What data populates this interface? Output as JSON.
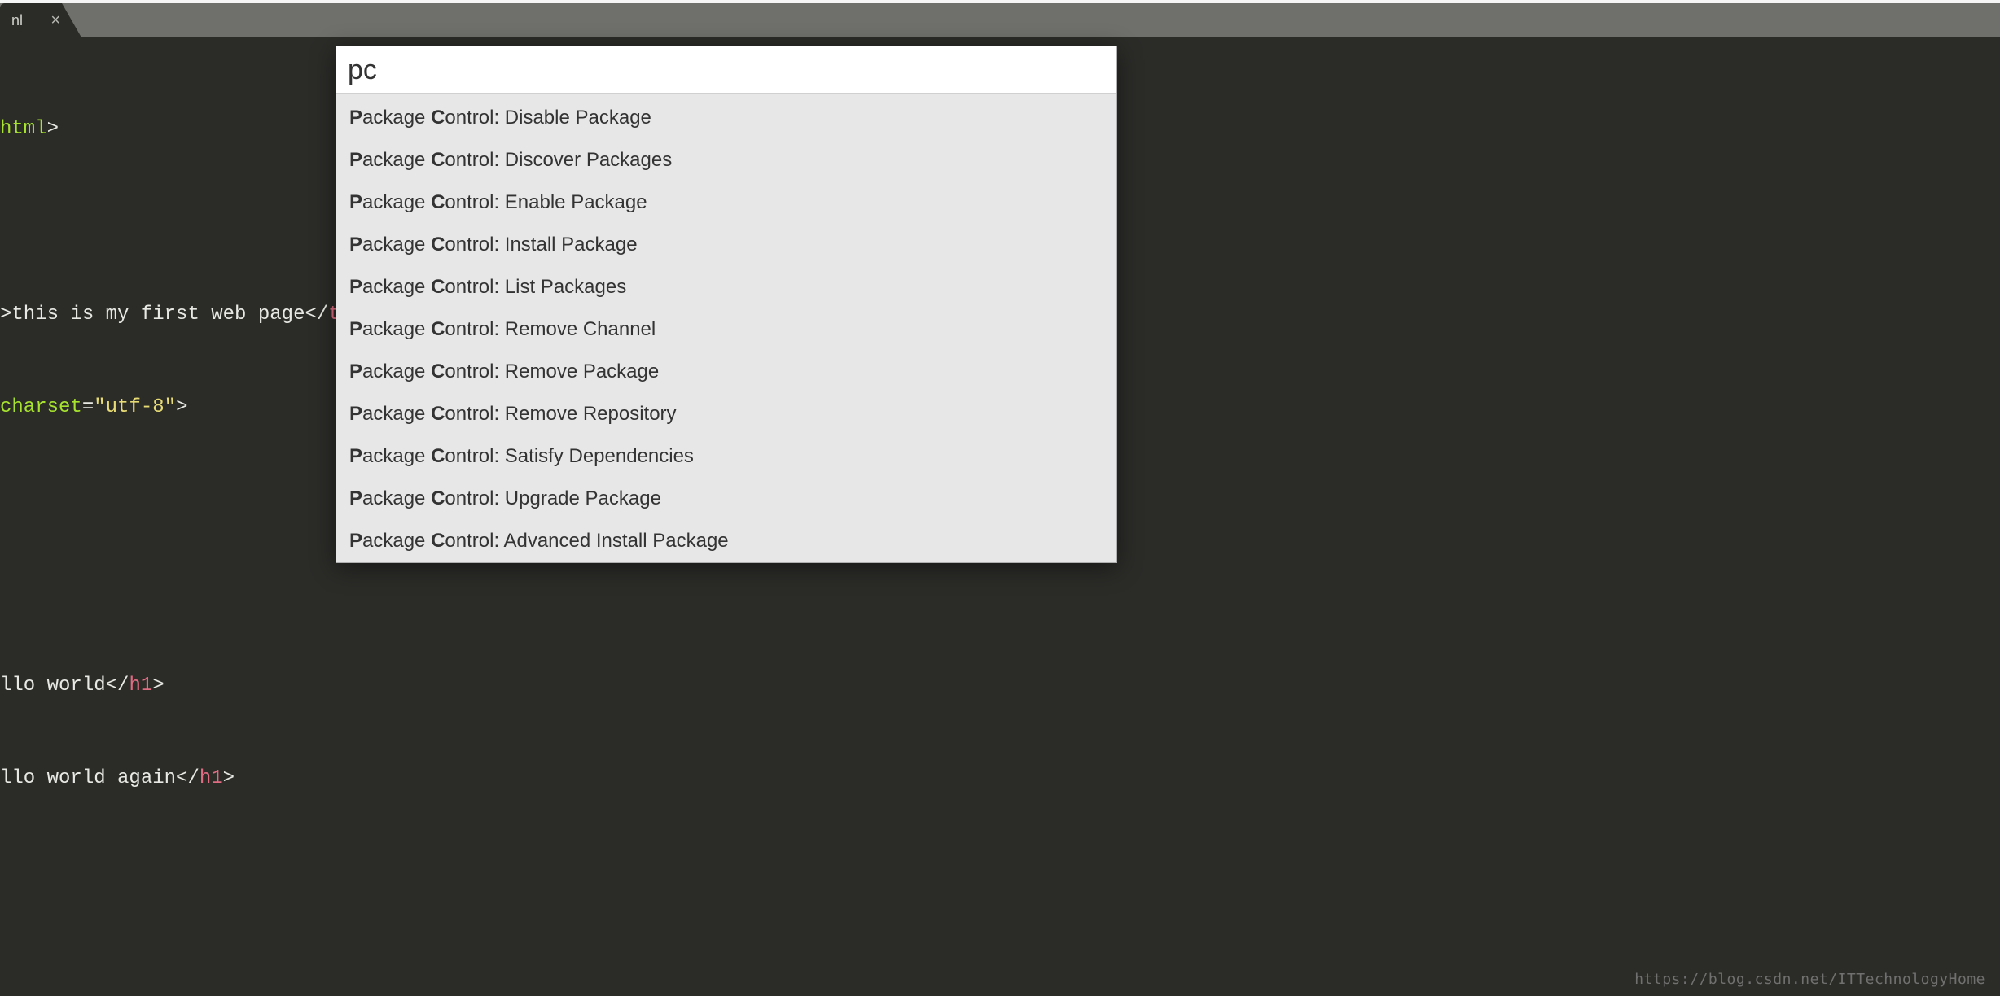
{
  "tab": {
    "label": "nl",
    "close_glyph": "×"
  },
  "code": {
    "l1": {
      "a": "html",
      "b": ">"
    },
    "l2": {
      "a": ">",
      "b": "this is my first web page",
      "c": "</",
      "d": "titl"
    },
    "l3": {
      "a": "charset",
      "b": "=",
      "c": "\"utf-8\"",
      "d": ">"
    },
    "l4": {
      "a": "llo world",
      "b": "</",
      "c": "h1",
      "d": ">"
    },
    "l5": {
      "a": "llo world again",
      "b": "</",
      "c": "h1",
      "d": ">"
    }
  },
  "palette": {
    "query": "pc",
    "items": [
      {
        "p1": "P",
        "p2": "ackage ",
        "p3": "C",
        "p4": "ontrol: Disable Package"
      },
      {
        "p1": "P",
        "p2": "ackage ",
        "p3": "C",
        "p4": "ontrol: Discover Packages"
      },
      {
        "p1": "P",
        "p2": "ackage ",
        "p3": "C",
        "p4": "ontrol: Enable Package"
      },
      {
        "p1": "P",
        "p2": "ackage ",
        "p3": "C",
        "p4": "ontrol: Install Package"
      },
      {
        "p1": "P",
        "p2": "ackage ",
        "p3": "C",
        "p4": "ontrol: List Packages"
      },
      {
        "p1": "P",
        "p2": "ackage ",
        "p3": "C",
        "p4": "ontrol: Remove Channel"
      },
      {
        "p1": "P",
        "p2": "ackage ",
        "p3": "C",
        "p4": "ontrol: Remove Package"
      },
      {
        "p1": "P",
        "p2": "ackage ",
        "p3": "C",
        "p4": "ontrol: Remove Repository"
      },
      {
        "p1": "P",
        "p2": "ackage ",
        "p3": "C",
        "p4": "ontrol: Satisfy Dependencies"
      },
      {
        "p1": "P",
        "p2": "ackage ",
        "p3": "C",
        "p4": "ontrol: Upgrade Package"
      },
      {
        "p1": "P",
        "p2": "ackage ",
        "p3": "C",
        "p4": "ontrol: Advanced Install Package"
      }
    ]
  },
  "watermark": "https://blog.csdn.net/ITTechnologyHome"
}
